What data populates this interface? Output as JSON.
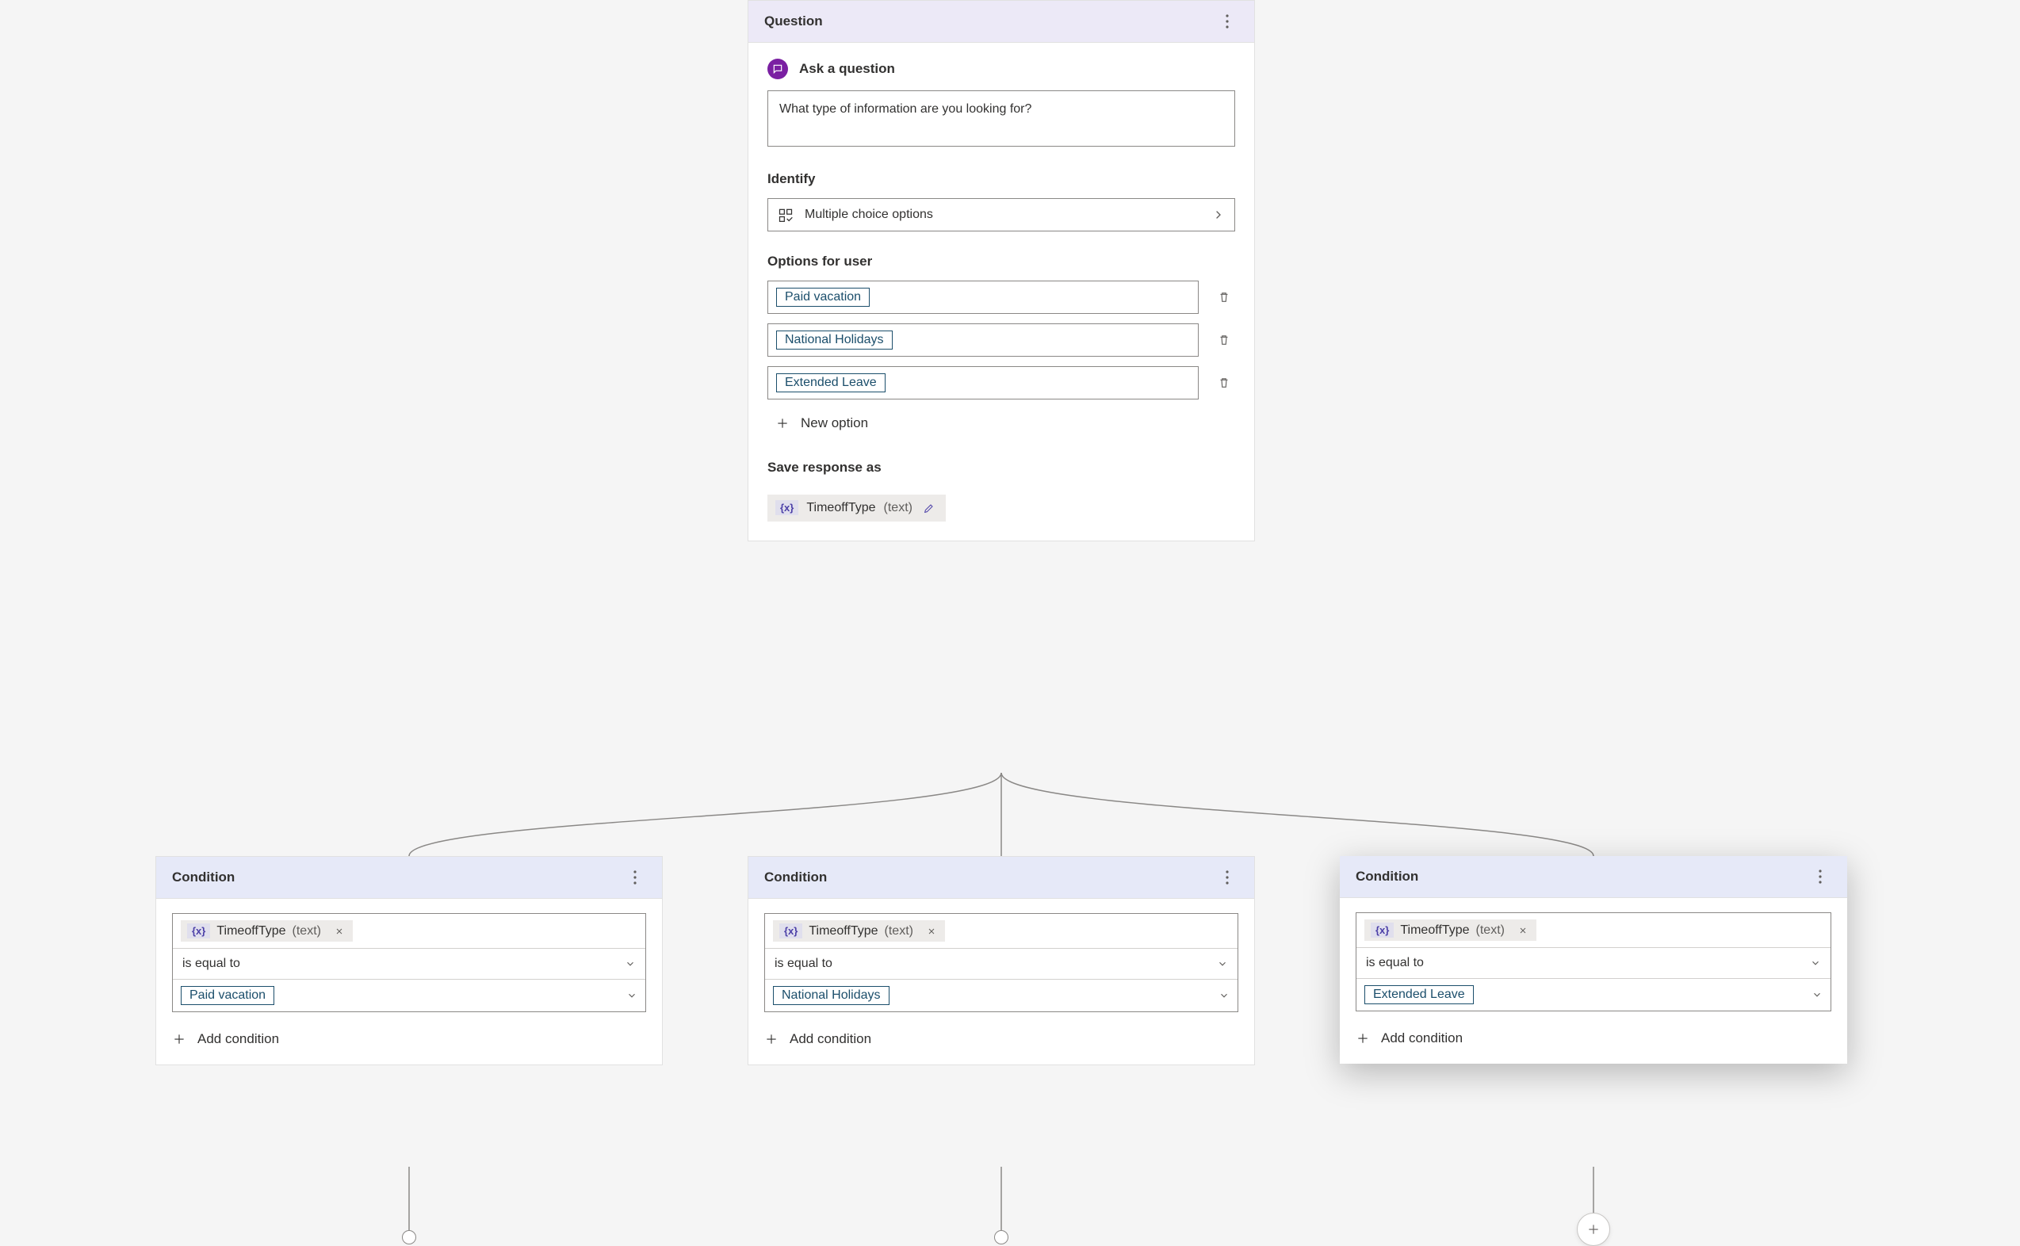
{
  "question_card": {
    "header": "Question",
    "ask_label": "Ask a question",
    "prompt_text": "What type of information are you looking for?",
    "identify_label": "Identify",
    "identify_value": "Multiple choice options",
    "options_label": "Options for user",
    "options": [
      "Paid vacation",
      "National Holidays",
      "Extended Leave"
    ],
    "new_option_label": "New option",
    "save_label": "Save response as",
    "variable_name": "TimeoffType",
    "variable_type": "(text)",
    "var_badge": "{x}"
  },
  "conditions": [
    {
      "header": "Condition",
      "var_badge": "{x}",
      "variable_name": "TimeoffType",
      "variable_type": "(text)",
      "operator": "is equal to",
      "value": "Paid vacation",
      "add_label": "Add condition"
    },
    {
      "header": "Condition",
      "var_badge": "{x}",
      "variable_name": "TimeoffType",
      "variable_type": "(text)",
      "operator": "is equal to",
      "value": "National Holidays",
      "add_label": "Add condition"
    },
    {
      "header": "Condition",
      "var_badge": "{x}",
      "variable_name": "TimeoffType",
      "variable_type": "(text)",
      "operator": "is equal to",
      "value": "Extended Leave",
      "add_label": "Add condition"
    }
  ]
}
